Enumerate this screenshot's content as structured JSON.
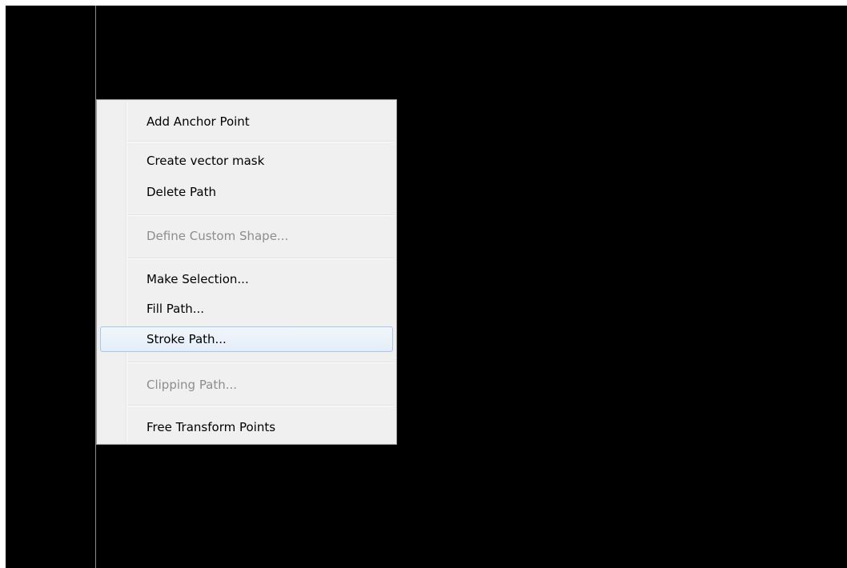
{
  "context_menu": {
    "items": [
      {
        "label": "Add Anchor Point",
        "enabled": true,
        "highlighted": false
      },
      {
        "label": "Create vector mask",
        "enabled": true,
        "highlighted": false
      },
      {
        "label": "Delete Path",
        "enabled": true,
        "highlighted": false
      },
      {
        "label": "Define Custom Shape...",
        "enabled": false,
        "highlighted": false
      },
      {
        "label": "Make Selection...",
        "enabled": true,
        "highlighted": false
      },
      {
        "label": "Fill Path...",
        "enabled": true,
        "highlighted": false
      },
      {
        "label": "Stroke Path...",
        "enabled": true,
        "highlighted": true
      },
      {
        "label": "Clipping Path...",
        "enabled": false,
        "highlighted": false
      },
      {
        "label": "Free Transform Points",
        "enabled": true,
        "highlighted": false
      }
    ]
  },
  "colors": {
    "canvas_background": "#000000",
    "menu_background": "#f0f0f0",
    "highlight_border": "#a8c7ea",
    "disabled_text": "#8d8d8d"
  }
}
